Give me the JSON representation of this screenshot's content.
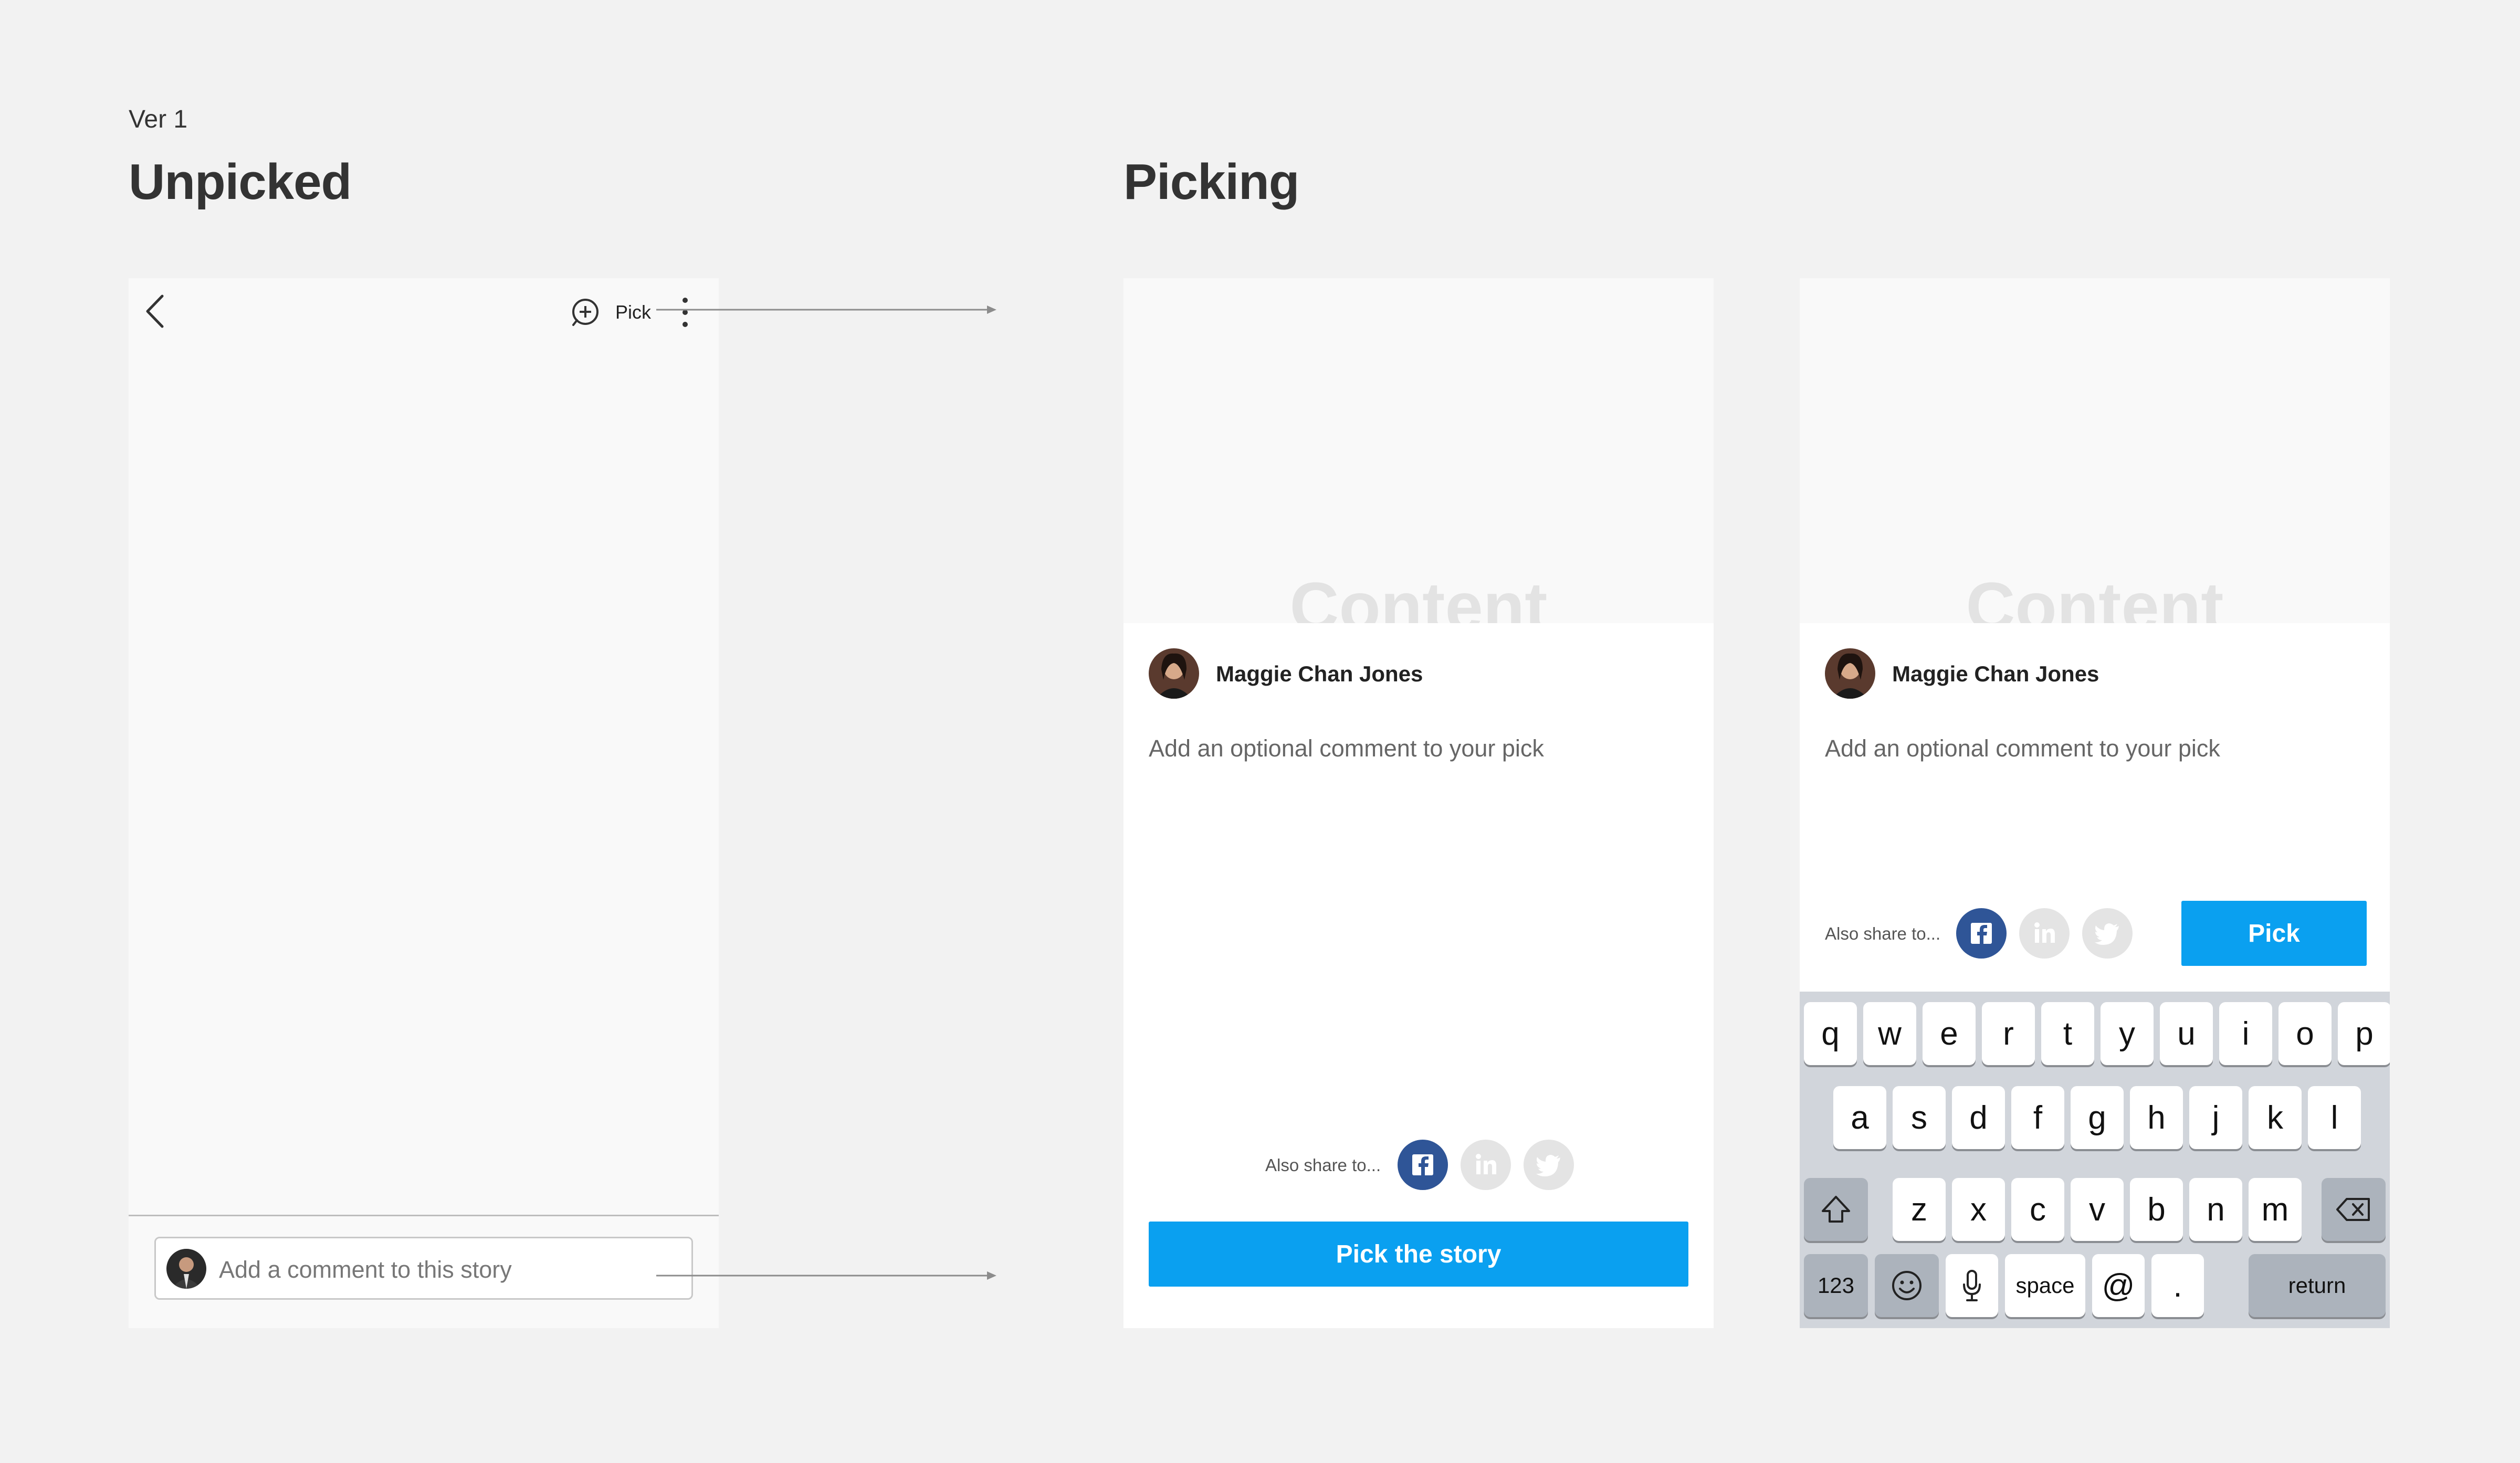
{
  "version_label": "Ver 1",
  "sections": {
    "unpicked_title": "Unpicked",
    "picking_title": "Picking"
  },
  "unpicked_screen": {
    "pick_label": "Pick",
    "comment_placeholder": "Add a comment to this story"
  },
  "picking_screen": {
    "content_placeholder": "Content",
    "author_name": "Maggie Chan Jones",
    "comment_prompt": "Add an optional comment to your pick",
    "share_label": "Also share to...",
    "share_targets": [
      "facebook-icon",
      "linkedin-icon",
      "twitter-icon"
    ],
    "primary_button": "Pick the story"
  },
  "picking_keyboard_screen": {
    "content_placeholder": "Content",
    "author_name": "Maggie Chan Jones",
    "comment_prompt": "Add an optional comment to your pick",
    "share_label": "Also share to...",
    "pick_button": "Pick",
    "keyboard": {
      "row1": [
        "q",
        "w",
        "e",
        "r",
        "t",
        "y",
        "u",
        "i",
        "o",
        "p"
      ],
      "row2": [
        "a",
        "s",
        "d",
        "f",
        "g",
        "h",
        "j",
        "k",
        "l"
      ],
      "row3": [
        "z",
        "x",
        "c",
        "v",
        "b",
        "n",
        "m"
      ],
      "numbers_key": "123",
      "space_key": "space",
      "at_key": "@",
      "period_key": ".",
      "return_key": "return"
    }
  },
  "colors": {
    "accent": "#0aa0f0",
    "facebook": "#2f5597",
    "inactive_social": "#e4e4e4",
    "background": "#f2f2f2"
  }
}
